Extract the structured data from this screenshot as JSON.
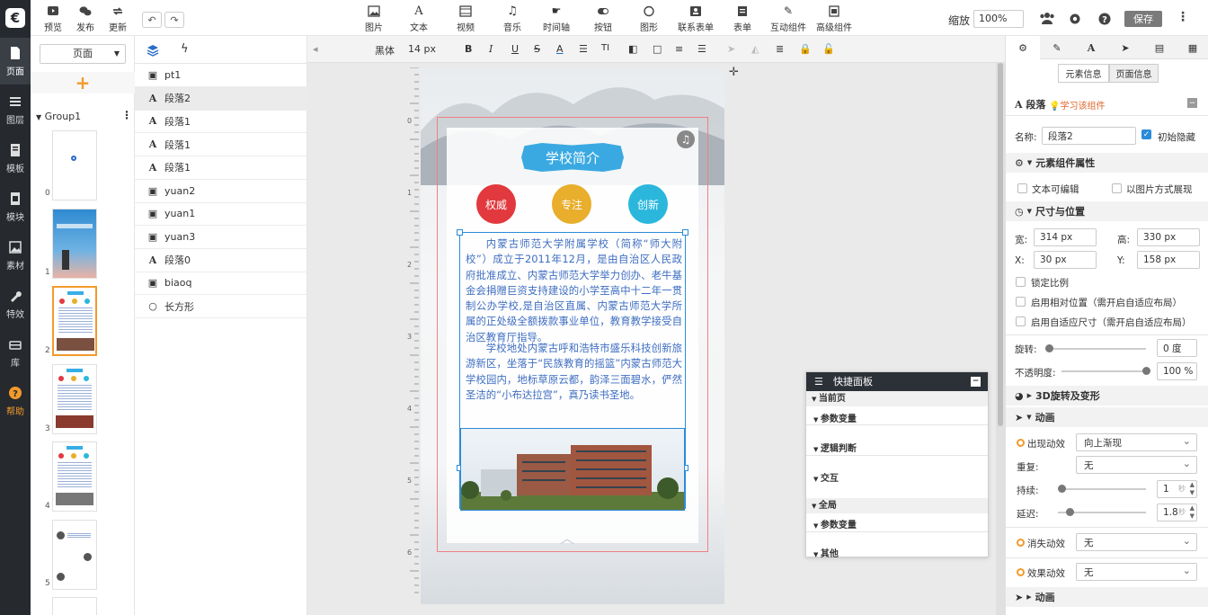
{
  "leftbar": {
    "logo": "€",
    "items": [
      {
        "label": "页面",
        "icon": "page-icon"
      },
      {
        "label": "图层",
        "icon": "layers-icon"
      },
      {
        "label": "模板",
        "icon": "template-icon"
      },
      {
        "label": "模块",
        "icon": "module-icon"
      },
      {
        "label": "素材",
        "icon": "image-icon"
      },
      {
        "label": "特效",
        "icon": "wrench-icon"
      },
      {
        "label": "库",
        "icon": "library-icon"
      },
      {
        "label": "帮助",
        "icon": "help-icon"
      }
    ]
  },
  "topbar": {
    "left": [
      {
        "label": "预览"
      },
      {
        "label": "发布"
      },
      {
        "label": "更新"
      }
    ],
    "insert": [
      {
        "label": "图片"
      },
      {
        "label": "文本"
      },
      {
        "label": "视频"
      },
      {
        "label": "音乐"
      },
      {
        "label": "时间轴"
      },
      {
        "label": "按钮"
      },
      {
        "label": "图形"
      },
      {
        "label": "联系表单"
      },
      {
        "label": "表单"
      },
      {
        "label": "互动组件"
      },
      {
        "label": "高级组件"
      }
    ],
    "zoom_label": "缩放",
    "zoom_value": "100%",
    "save": "保存"
  },
  "pages_panel": {
    "dropdown": "页面",
    "group": "Group1",
    "page_numbers": [
      "0",
      "1",
      "2",
      "3",
      "4",
      "5"
    ]
  },
  "layers": [
    {
      "name": "pt1",
      "type": "image"
    },
    {
      "name": "段落2",
      "type": "text"
    },
    {
      "name": "段落1",
      "type": "text"
    },
    {
      "name": "段落1",
      "type": "text"
    },
    {
      "name": "段落1",
      "type": "text"
    },
    {
      "name": "yuan2",
      "type": "image"
    },
    {
      "name": "yuan1",
      "type": "image"
    },
    {
      "name": "yuan3",
      "type": "image"
    },
    {
      "name": "段落0",
      "type": "text"
    },
    {
      "name": "biaoq",
      "type": "image"
    },
    {
      "name": "长方形",
      "type": "shape"
    }
  ],
  "format_bar": {
    "font": "黑体",
    "size": "14 px"
  },
  "ruler": {
    "labels": [
      "0",
      "1",
      "2",
      "3",
      "4",
      "5",
      "6"
    ]
  },
  "stage": {
    "banner": "学校简介",
    "circles": [
      {
        "label": "权威",
        "color": "#e1393e"
      },
      {
        "label": "专注",
        "color": "#e8ae2c"
      },
      {
        "label": "创新",
        "color": "#2bb7dc"
      }
    ],
    "paragraph1": "内蒙古师范大学附属学校（简称“师大附校”）成立于2011年12月，是由自治区人民政府批准成立、内蒙古师范大学举力创办、老牛基金会捐赠巨资支持建设的小学至高中十二年一贯制公办学校,是自治区直属、内蒙古师范大学所属的正处级全额拨款事业单位，教育教学接受自治区教育厅指导。",
    "paragraph2": "学校地处内蒙古呼和浩特市盛乐科技创新旅游新区，坐落于“民族教育的摇篮”内蒙古师范大学校园内，地标草原云都，韵泽三面碧水，俨然圣洁的“小布达拉宫”，真乃读书圣地。"
  },
  "quick_panel": {
    "title": "快捷面板",
    "current_page": "当前页",
    "items_current": [
      "参数变量",
      "逻辑判断",
      "交互"
    ],
    "global": "全局",
    "items_global": [
      "参数变量",
      "其他"
    ]
  },
  "right_panel": {
    "tabs": [
      "元素信息",
      "页面信息"
    ],
    "element_title": "段落",
    "learn": "学习该组件",
    "name_label": "名称:",
    "name_value": "段落2",
    "hidden_label": "初始隐藏",
    "sec_props": "元素组件属性",
    "text_editable": "文本可编辑",
    "as_image": "以图片方式展现",
    "sec_size": "尺寸与位置",
    "w_label": "宽:",
    "w_value": "314 px",
    "h_label": "高:",
    "h_value": "330 px",
    "x_label": "X:",
    "x_value": "30 px",
    "y_label": "Y:",
    "y_value": "158 px",
    "lock_ratio": "锁定比例",
    "relative_pos": "启用相对位置（需开启自适应布局）",
    "adaptive_size": "启用自适应尺寸（需开启自适应布局）",
    "rotate_label": "旋转:",
    "rotate_value": "0 度",
    "opacity_label": "不透明度:",
    "opacity_value": "100 %",
    "rotation_fraction": 0.0,
    "opacity_fraction": 1.0,
    "sec_3d": "3D旋转及变形",
    "sec_anim": "动画",
    "appear_label": "出现动效",
    "appear_value": "向上渐现",
    "repeat_label": "重复:",
    "repeat_value": "无",
    "duration_label": "持续:",
    "duration_value": "1",
    "delay_label": "延迟:",
    "delay_value": "1.8",
    "sec_unit": "秒",
    "disappear_label": "消失动效",
    "disappear_value": "无",
    "effect_label": "效果动效",
    "effect_value": "无",
    "sec_animation": "动画"
  },
  "colors": {
    "accent": "#f39a2b",
    "save": "#7a7a7a",
    "selection": "#2a8bd9",
    "stage_text": "#3e6ec1"
  }
}
